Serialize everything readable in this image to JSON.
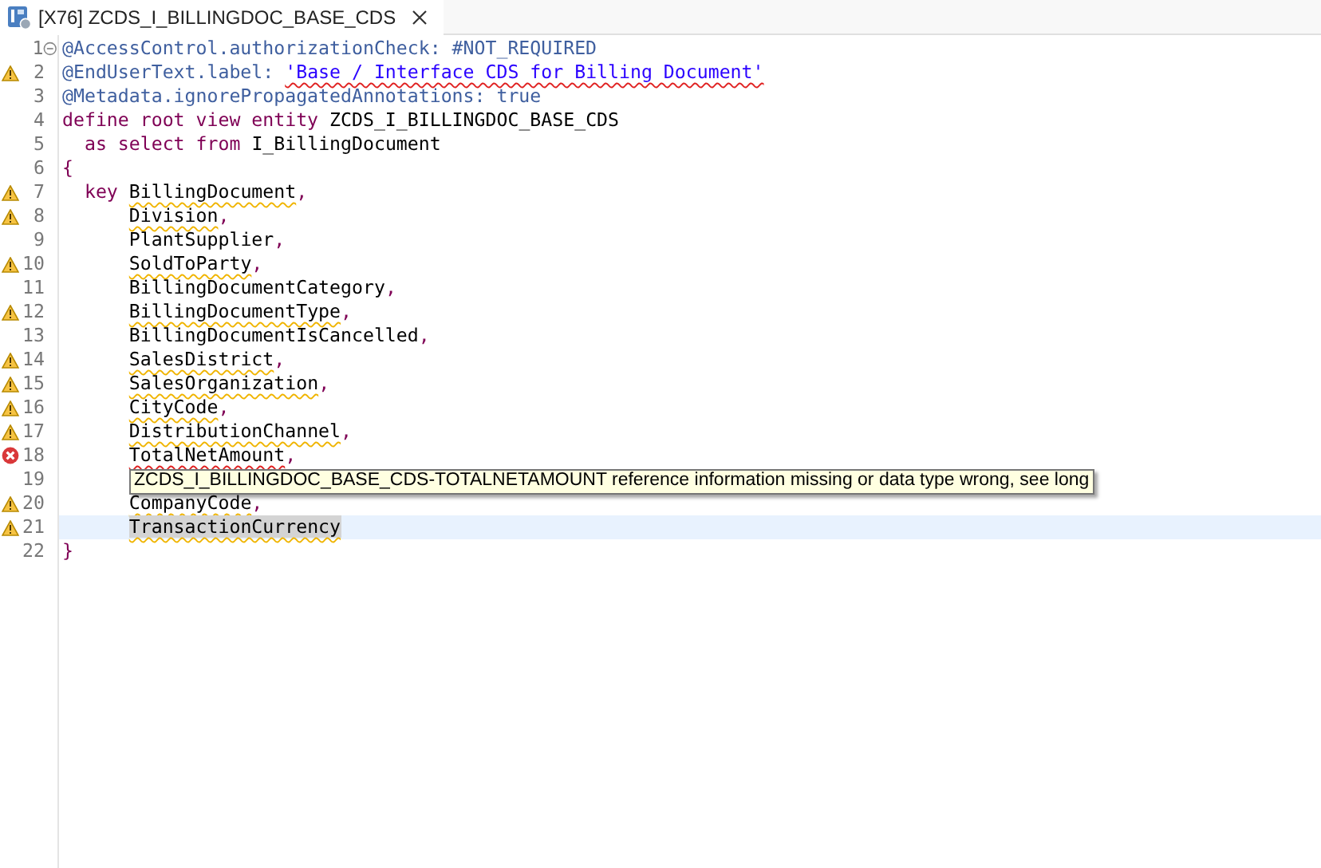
{
  "tab": {
    "title": "[X76] ZCDS_I_BILLINGDOC_BASE_CDS",
    "selected": true
  },
  "lines": [
    {
      "number": "1",
      "warning": false,
      "error": false,
      "fold": true,
      "current": false,
      "segments": [
        {
          "text": "@AccessControl.authorizationCheck: #NOT_REQUIRED",
          "kind": "annotation"
        }
      ]
    },
    {
      "number": "2",
      "warning": true,
      "error": false,
      "current": false,
      "segments": [
        {
          "text": "@EndUserText.label: ",
          "kind": "annotation"
        },
        {
          "text": "'Base / Interface CDS for Billing Document'",
          "kind": "string",
          "error": true
        }
      ]
    },
    {
      "number": "3",
      "warning": false,
      "error": false,
      "current": false,
      "segments": [
        {
          "text": "@Metadata.ignorePropagatedAnnotations: true",
          "kind": "annotation"
        }
      ]
    },
    {
      "number": "4",
      "warning": false,
      "error": false,
      "current": false,
      "segments": [
        {
          "text": "define root view entity",
          "kind": "keyword"
        },
        {
          "text": " ZCDS_I_BILLINGDOC_BASE_CDS",
          "kind": "plain"
        }
      ]
    },
    {
      "number": "5",
      "warning": false,
      "error": false,
      "current": false,
      "segments": [
        {
          "text": "  as select from",
          "kind": "keyword"
        },
        {
          "text": " I_BillingDocument",
          "kind": "plain"
        }
      ]
    },
    {
      "number": "6",
      "warning": false,
      "error": false,
      "current": false,
      "segments": [
        {
          "text": "{",
          "kind": "punct"
        }
      ]
    },
    {
      "number": "7",
      "warning": true,
      "error": false,
      "current": false,
      "segments": [
        {
          "text": "  key",
          "kind": "keyword"
        },
        {
          "text": " BillingDocument",
          "kind": "plain",
          "warning": true
        },
        {
          "text": ",",
          "kind": "punct"
        }
      ]
    },
    {
      "number": "8",
      "warning": true,
      "error": false,
      "current": false,
      "segments": [
        {
          "text": "      Division",
          "kind": "plain",
          "warning": true
        },
        {
          "text": ",",
          "kind": "punct"
        }
      ]
    },
    {
      "number": "9",
      "warning": false,
      "error": false,
      "current": false,
      "segments": [
        {
          "text": "      PlantSupplier",
          "kind": "plain"
        },
        {
          "text": ",",
          "kind": "punct"
        }
      ]
    },
    {
      "number": "10",
      "warning": true,
      "error": false,
      "current": false,
      "segments": [
        {
          "text": "      SoldToParty",
          "kind": "plain",
          "warning": true
        },
        {
          "text": ",",
          "kind": "punct"
        }
      ]
    },
    {
      "number": "11",
      "warning": false,
      "error": false,
      "current": false,
      "segments": [
        {
          "text": "      BillingDocumentCategory",
          "kind": "plain"
        },
        {
          "text": ",",
          "kind": "punct"
        }
      ]
    },
    {
      "number": "12",
      "warning": true,
      "error": false,
      "current": false,
      "segments": [
        {
          "text": "      BillingDocumentType",
          "kind": "plain",
          "warning": true
        },
        {
          "text": ",",
          "kind": "punct"
        }
      ]
    },
    {
      "number": "13",
      "warning": false,
      "error": false,
      "current": false,
      "segments": [
        {
          "text": "      BillingDocumentIsCancelled",
          "kind": "plain"
        },
        {
          "text": ",",
          "kind": "punct"
        }
      ]
    },
    {
      "number": "14",
      "warning": true,
      "error": false,
      "current": false,
      "segments": [
        {
          "text": "      SalesDistrict",
          "kind": "plain",
          "warning": true
        },
        {
          "text": ",",
          "kind": "punct"
        }
      ]
    },
    {
      "number": "15",
      "warning": true,
      "error": false,
      "current": false,
      "segments": [
        {
          "text": "      SalesOrganization",
          "kind": "plain",
          "warning": true
        },
        {
          "text": ",",
          "kind": "punct"
        }
      ]
    },
    {
      "number": "16",
      "warning": true,
      "error": false,
      "current": false,
      "segments": [
        {
          "text": "      CityCode",
          "kind": "plain",
          "warning": true
        },
        {
          "text": ",",
          "kind": "punct"
        }
      ]
    },
    {
      "number": "17",
      "warning": true,
      "error": false,
      "current": false,
      "segments": [
        {
          "text": "      DistributionChannel",
          "kind": "plain",
          "warning": true
        },
        {
          "text": ",",
          "kind": "punct"
        }
      ]
    },
    {
      "number": "18",
      "warning": false,
      "error": true,
      "current": false,
      "segments": [
        {
          "text": "      TotalNetAmount",
          "kind": "plain",
          "error": true
        },
        {
          "text": ",",
          "kind": "punct"
        }
      ]
    },
    {
      "number": "19",
      "warning": false,
      "error": false,
      "current": false
    },
    {
      "number": "20",
      "warning": true,
      "error": false,
      "current": false,
      "segments": [
        {
          "text": "      CompanyCode",
          "kind": "plain",
          "warning": true
        },
        {
          "text": ",",
          "kind": "punct"
        }
      ]
    },
    {
      "number": "21",
      "warning": true,
      "error": false,
      "current": true,
      "segments": [
        {
          "text": "      TransactionCurrency",
          "kind": "plain",
          "warning": true,
          "selected": true
        }
      ]
    },
    {
      "number": "22",
      "warning": false,
      "error": false,
      "current": false,
      "segments": [
        {
          "text": "}",
          "kind": "punct"
        }
      ]
    }
  ],
  "tooltip": {
    "text": "ZCDS_I_BILLINGDOC_BASE_CDS-TOTALNETAMOUNT reference information missing or data type wrong, see long"
  }
}
